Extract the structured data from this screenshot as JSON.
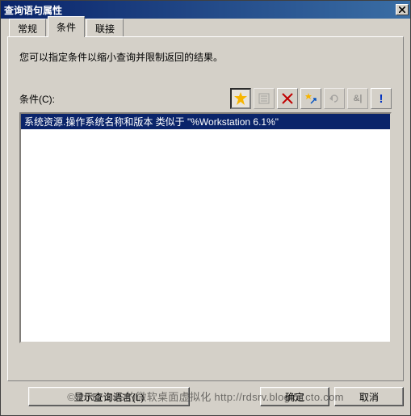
{
  "window": {
    "title": "查询语句属性"
  },
  "tabs": [
    {
      "label": "常规"
    },
    {
      "label": "条件"
    },
    {
      "label": "联接"
    }
  ],
  "active_tab_index": 1,
  "panel": {
    "description": "您可以指定条件以缩小查询并限制返回的结果。",
    "criteria_label": "条件(C):"
  },
  "toolbar": {
    "icons": {
      "new": "star",
      "properties": "props",
      "delete": "delete",
      "highlight": "star-arrow",
      "undo": "undo",
      "and": "&|",
      "info": "!"
    }
  },
  "criteria_rows": [
    "系统资源.操作系统名称和版本 类似于 \"%Workstation 6.1%\""
  ],
  "buttons": {
    "show_query": "显示查询语言(L)",
    "ok": "确定",
    "cancel": "取消"
  },
  "watermark": "© 2012 ZJS的微软桌面虚拟化  http://rdsrv.blog.51cto.com"
}
